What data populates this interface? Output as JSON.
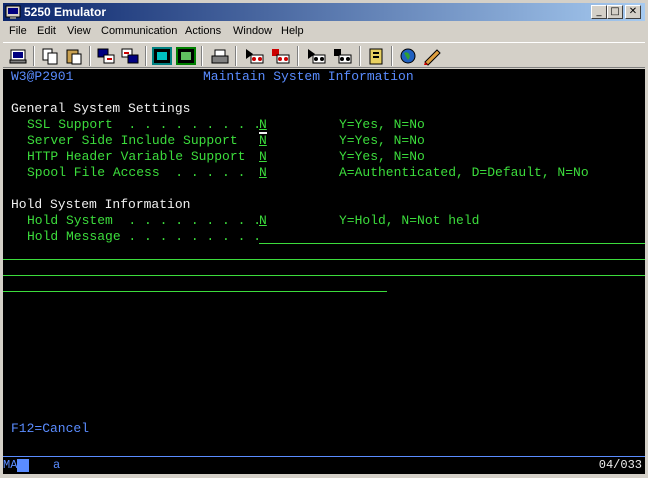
{
  "window": {
    "title": "5250 Emulator"
  },
  "menu": [
    "File",
    "Edit",
    "View",
    "Communication",
    "Actions",
    "Window",
    "Help"
  ],
  "toolbar_icons": [
    "print-screen-icon",
    "copy-icon",
    "paste-icon",
    "send-icon",
    "receive-icon",
    "display-icon",
    "keyboard-icon",
    "macro-icon",
    "record-icon",
    "stop-record-icon",
    "play-icon",
    "play-macro-icon",
    "pause-icon",
    "clipboard-icon",
    "globe-icon",
    "edit-icon"
  ],
  "screen": {
    "program_id": "W3@P2901",
    "title": "Maintain System Information",
    "general_header": "General System Settings",
    "fields": [
      {
        "label": "SSL Support  . . . . . . . . .",
        "value": "N",
        "hint": "Y=Yes, N=No"
      },
      {
        "label": "Server Side Include Support",
        "value": "N",
        "hint": "Y=Yes, N=No"
      },
      {
        "label": "HTTP Header Variable Support",
        "value": "N",
        "hint": "Y=Yes, N=No"
      },
      {
        "label": "Spool File Access  . . . . .",
        "value": "N",
        "hint": "A=Authenticated, D=Default, N=No"
      }
    ],
    "hold_header": "Hold System Information",
    "hold_system": {
      "label": "Hold System  . . . . . . . . .",
      "value": "N",
      "hint": "Y=Hold, N=Not held"
    },
    "hold_message": {
      "label": "Hold Message . . . . . . . . .",
      "value": ""
    },
    "function_keys": "F12=Cancel"
  },
  "oia": {
    "mode": "MA",
    "indicator": "a",
    "cursor_pos": "04/033"
  },
  "colors": {
    "screen_bg": "#000000",
    "field_green": "#3cdc3c",
    "title_blue": "#5a8cff",
    "titlebar": "#0a246a"
  }
}
